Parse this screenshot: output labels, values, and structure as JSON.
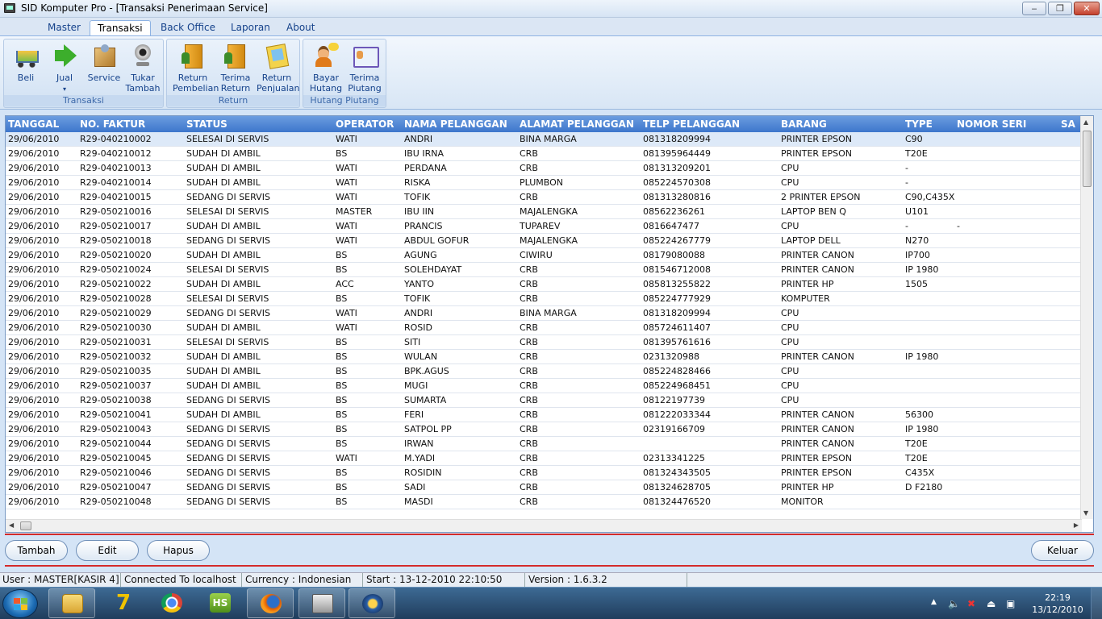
{
  "window": {
    "title": "SID Komputer Pro - [Transaksi Penerimaan Service]"
  },
  "tabs": [
    "Master",
    "Transaksi",
    "Back Office",
    "Laporan",
    "About"
  ],
  "active_tab": "Transaksi",
  "ribbon": {
    "groups": [
      {
        "label": "Transaksi",
        "buttons": [
          {
            "label1": "Beli",
            "label2": "",
            "icon": "cart-icon"
          },
          {
            "label1": "Jual",
            "label2": "▾",
            "icon": "green-arrow-icon"
          },
          {
            "label1": "Service",
            "label2": "",
            "icon": "box-icon"
          },
          {
            "label1": "Tukar",
            "label2": "Tambah",
            "icon": "webcam-icon"
          }
        ]
      },
      {
        "label": "Return",
        "buttons": [
          {
            "label1": "Return",
            "label2": "Pembelian",
            "icon": "door-person-icon"
          },
          {
            "label1": "Terima",
            "label2": "Return",
            "icon": "door-icon"
          },
          {
            "label1": "Return",
            "label2": "Penjualan",
            "icon": "note-icon"
          }
        ]
      },
      {
        "label": "Hutang Piutang",
        "buttons": [
          {
            "label1": "Bayar",
            "label2": "Hutang",
            "icon": "person-bubble-icon"
          },
          {
            "label1": "Terima",
            "label2": "Piutang",
            "icon": "id-card-icon"
          }
        ]
      }
    ]
  },
  "grid": {
    "columns": [
      "TANGGAL",
      "NO. FAKTUR",
      "STATUS",
      "OPERATOR",
      "NAMA PELANGGAN",
      "ALAMAT PELANGGAN",
      "TELP PELANGGAN",
      "BARANG",
      "TYPE",
      "NOMOR SERI",
      "SA"
    ],
    "rows": [
      [
        "29/06/2010",
        "R29-040210002",
        "SELESAI DI SERVIS",
        "WATI",
        "ANDRI",
        "BINA MARGA",
        "081318209994",
        "PRINTER EPSON",
        "C90",
        ""
      ],
      [
        "29/06/2010",
        "R29-040210012",
        "SUDAH DI AMBIL",
        "BS",
        "IBU IRNA",
        "CRB",
        "081395964449",
        "PRINTER EPSON",
        "T20E",
        ""
      ],
      [
        "29/06/2010",
        "R29-040210013",
        "SUDAH DI AMBIL",
        "WATI",
        "PERDANA",
        "CRB",
        "081313209201",
        "CPU",
        "-",
        ""
      ],
      [
        "29/06/2010",
        "R29-040210014",
        "SUDAH DI AMBIL",
        "WATI",
        "RISKA",
        "PLUMBON",
        "085224570308",
        "CPU",
        "-",
        ""
      ],
      [
        "29/06/2010",
        "R29-040210015",
        "SEDANG DI SERVIS",
        "WATI",
        "TOFIK",
        "CRB",
        "081313280816",
        "2 PRINTER EPSON",
        "C90,C435X",
        ""
      ],
      [
        "29/06/2010",
        "R29-050210016",
        "SELESAI DI SERVIS",
        "MASTER",
        "IBU IIN",
        "MAJALENGKA",
        "08562236261",
        "LAPTOP BEN Q",
        "U101",
        ""
      ],
      [
        "29/06/2010",
        "R29-050210017",
        "SUDAH DI AMBIL",
        "WATI",
        "PRANCIS",
        "TUPAREV",
        "0816647477",
        "CPU",
        "-",
        "-"
      ],
      [
        "29/06/2010",
        "R29-050210018",
        "SEDANG DI SERVIS",
        "WATI",
        "ABDUL GOFUR",
        "MAJALENGKA",
        "085224267779",
        "LAPTOP DELL",
        "N270",
        ""
      ],
      [
        "29/06/2010",
        "R29-050210020",
        "SUDAH DI AMBIL",
        "BS",
        "AGUNG",
        "CIWIRU",
        "08179080088",
        "PRINTER CANON",
        "IP700",
        ""
      ],
      [
        "29/06/2010",
        "R29-050210024",
        "SELESAI DI SERVIS",
        "BS",
        "SOLEHDAYAT",
        "CRB",
        "081546712008",
        "PRINTER CANON",
        "IP 1980",
        ""
      ],
      [
        "29/06/2010",
        "R29-050210022",
        "SUDAH DI AMBIL",
        "ACC",
        "YANTO",
        "CRB",
        "085813255822",
        "PRINTER HP",
        "1505",
        ""
      ],
      [
        "29/06/2010",
        "R29-050210028",
        "SELESAI DI SERVIS",
        "BS",
        "TOFIK",
        "CRB",
        "085224777929",
        "KOMPUTER",
        "",
        ""
      ],
      [
        "29/06/2010",
        "R29-050210029",
        "SEDANG DI SERVIS",
        "WATI",
        "ANDRI",
        "BINA MARGA",
        "081318209994",
        "CPU",
        "",
        ""
      ],
      [
        "29/06/2010",
        "R29-050210030",
        "SUDAH DI AMBIL",
        "WATI",
        "ROSID",
        "CRB",
        "085724611407",
        "CPU",
        "",
        ""
      ],
      [
        "29/06/2010",
        "R29-050210031",
        "SELESAI DI SERVIS",
        "BS",
        "SITI",
        "CRB",
        "081395761616",
        "CPU",
        "",
        ""
      ],
      [
        "29/06/2010",
        "R29-050210032",
        "SUDAH DI AMBIL",
        "BS",
        "WULAN",
        "CRB",
        "0231320988",
        "PRINTER CANON",
        "IP 1980",
        ""
      ],
      [
        "29/06/2010",
        "R29-050210035",
        "SUDAH DI AMBIL",
        "BS",
        "BPK.AGUS",
        "CRB",
        "085224828466",
        "CPU",
        "",
        ""
      ],
      [
        "29/06/2010",
        "R29-050210037",
        "SUDAH DI AMBIL",
        "BS",
        "MUGI",
        "CRB",
        "085224968451",
        "CPU",
        "",
        ""
      ],
      [
        "29/06/2010",
        "R29-050210038",
        "SEDANG DI SERVIS",
        "BS",
        "SUMARTA",
        "CRB",
        "08122197739",
        "CPU",
        "",
        ""
      ],
      [
        "29/06/2010",
        "R29-050210041",
        "SUDAH DI AMBIL",
        "BS",
        "FERI",
        "CRB",
        "081222033344",
        "PRINTER CANON",
        "56300",
        ""
      ],
      [
        "29/06/2010",
        "R29-050210043",
        "SEDANG DI SERVIS",
        "BS",
        "SATPOL PP",
        "CRB",
        "02319166709",
        "PRINTER CANON",
        "IP 1980",
        ""
      ],
      [
        "29/06/2010",
        "R29-050210044",
        "SEDANG DI SERVIS",
        "BS",
        "IRWAN",
        "CRB",
        "",
        "PRINTER CANON",
        "T20E",
        ""
      ],
      [
        "29/06/2010",
        "R29-050210045",
        "SEDANG DI SERVIS",
        "WATI",
        "M.YADI",
        "CRB",
        "02313341225",
        "PRINTER EPSON",
        "T20E",
        ""
      ],
      [
        "29/06/2010",
        "R29-050210046",
        "SEDANG DI SERVIS",
        "BS",
        "ROSIDIN",
        "CRB",
        "081324343505",
        "PRINTER EPSON",
        "C435X",
        ""
      ],
      [
        "29/06/2010",
        "R29-050210047",
        "SEDANG DI SERVIS",
        "BS",
        "SADI",
        "CRB",
        "081324628705",
        "PRINTER HP",
        "D F2180",
        ""
      ],
      [
        "29/06/2010",
        "R29-050210048",
        "SEDANG DI SERVIS",
        "BS",
        "MASDI",
        "CRB",
        "081324476520",
        "MONITOR",
        "",
        ""
      ]
    ]
  },
  "actions": {
    "tambah": "Tambah",
    "edit": "Edit",
    "hapus": "Hapus",
    "keluar": "Keluar"
  },
  "status": {
    "user": "User : MASTER[KASIR 4]",
    "connection": "Connected To localhost",
    "currency": "Currency : Indonesian",
    "start": "Start  : 13-12-2010 22:10:50",
    "version": "Version : 1.6.3.2"
  },
  "taskbar": {
    "items": [
      "folder-icon",
      "seven-icon",
      "chrome-icon",
      "hs-icon",
      "firefox-icon",
      "computer-icon",
      "monitor-app-icon"
    ],
    "hs_label": "HS",
    "clock_time": "22:19",
    "clock_date": "13/12/2010"
  },
  "colors": {
    "header_blue": "#3d76cc",
    "accent_red": "#d42a2a",
    "selected_row": "#dde9f8"
  }
}
